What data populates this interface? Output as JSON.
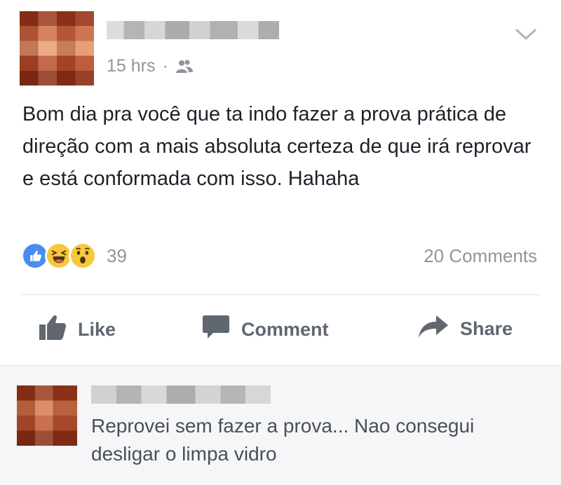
{
  "post": {
    "time": "15 hrs",
    "separator": "·",
    "audience_icon": "friends-icon",
    "text": "Bom dia pra você que ta indo fazer a prova prática de direção com a mais absoluta certeza de que irá reprovar e está conformada com isso. Hahaha",
    "reactions": {
      "types": [
        "like",
        "haha",
        "wow"
      ],
      "count": "39"
    },
    "comments_count": "20 Comments"
  },
  "actions": {
    "like_label": "Like",
    "comment_label": "Comment",
    "share_label": "Share"
  },
  "comment": {
    "text": "Reprovei sem fazer a prova... Nao consegui desligar o limpa vidro"
  },
  "colors": {
    "like_blue": "#4a8cf0",
    "reaction_yellow": "#f7c83b",
    "meta_gray": "#90949c",
    "action_gray": "#606770"
  }
}
